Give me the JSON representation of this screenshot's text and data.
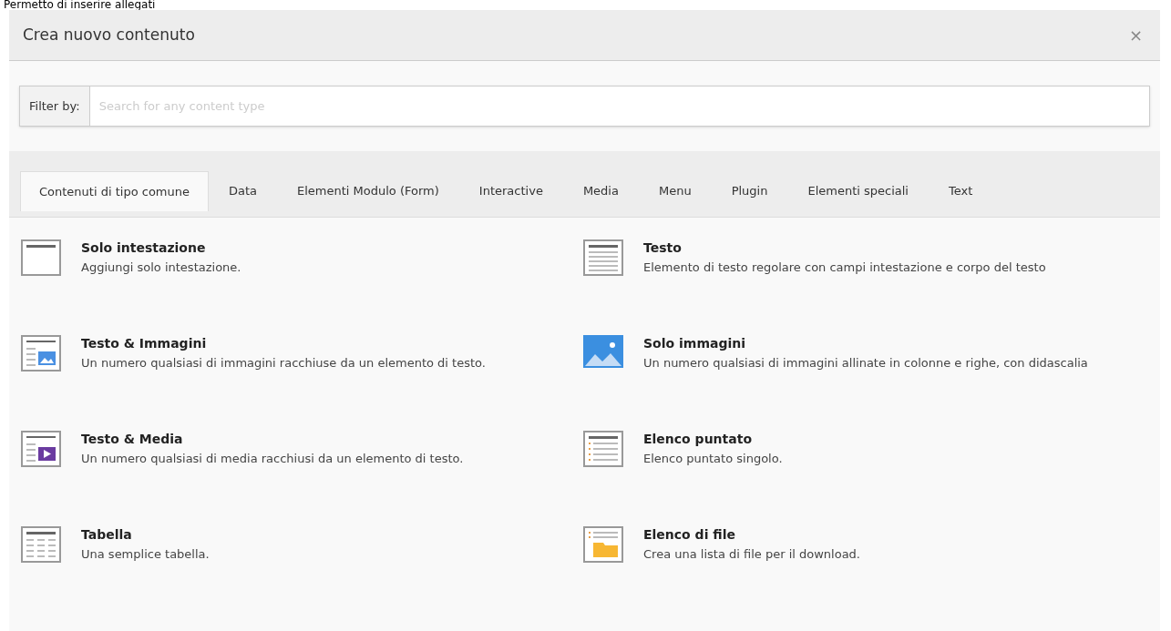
{
  "page_caption": "Permetto di inserire allegati",
  "dialog": {
    "title": "Crea nuovo contenuto",
    "close": "×"
  },
  "filter": {
    "label": "Filter by:",
    "placeholder": "Search for any content type"
  },
  "tabs": [
    {
      "label": "Contenuti di tipo comune",
      "selected": true
    },
    {
      "label": "Data",
      "selected": false
    },
    {
      "label": "Elementi Modulo (Form)",
      "selected": false
    },
    {
      "label": "Interactive",
      "selected": false
    },
    {
      "label": "Media",
      "selected": false
    },
    {
      "label": "Menu",
      "selected": false
    },
    {
      "label": "Plugin",
      "selected": false
    },
    {
      "label": "Elementi speciali",
      "selected": false
    },
    {
      "label": "Text",
      "selected": false
    }
  ],
  "items": [
    {
      "kind": "header",
      "title": "Solo intestazione",
      "description": "Aggiungi solo intestazione."
    },
    {
      "kind": "text",
      "title": "Testo",
      "description": "Elemento di testo regolare con campi intestazione e corpo del testo"
    },
    {
      "kind": "textpic",
      "title": "Testo & Immagini",
      "description": "Un numero qualsiasi di immagini racchiuse da un elemento di testo."
    },
    {
      "kind": "image",
      "title": "Solo immagini",
      "description": "Un numero qualsiasi di immagini allinate in colonne e righe, con didascalia"
    },
    {
      "kind": "textmedia",
      "title": "Testo & Media",
      "description": "Un numero qualsiasi di media racchiusi da un elemento di testo."
    },
    {
      "kind": "bullets",
      "title": "Elenco puntato",
      "description": "Elenco puntato singolo."
    },
    {
      "kind": "table",
      "title": "Tabella",
      "description": "Una semplice tabella."
    },
    {
      "kind": "uploads",
      "title": "Elenco di file",
      "description": "Crea una lista di file per il download."
    }
  ]
}
